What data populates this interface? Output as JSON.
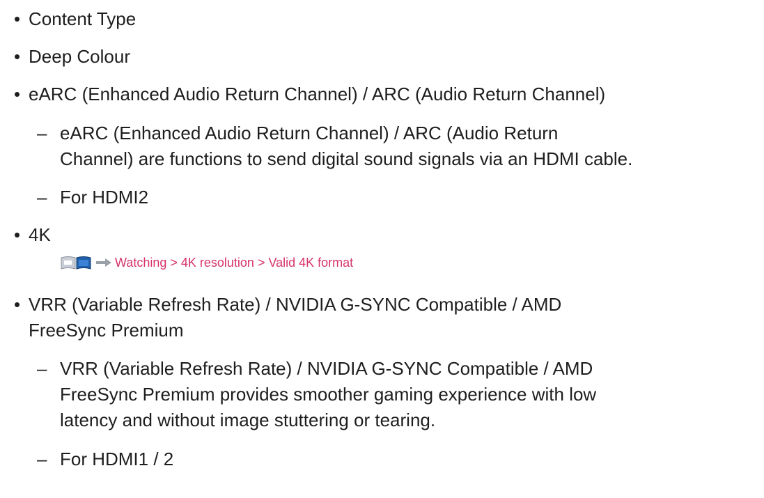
{
  "items": [
    {
      "bullet": "•",
      "text": "Content Type"
    },
    {
      "bullet": "•",
      "text": "Deep Colour"
    },
    {
      "bullet": "•",
      "text": "eARC (Enhanced Audio Return Channel) / ARC (Audio Return Channel)"
    },
    {
      "bullet": "•",
      "text": "4K"
    },
    {
      "bullet": "•",
      "lines": [
        "VRR (Variable Refresh Rate) / NVIDIA G-SYNC Compatible / AMD",
        "FreeSync Premium"
      ]
    }
  ],
  "sub_items": [
    {
      "dash": "–",
      "lines": [
        "eARC (Enhanced Audio Return Channel) / ARC (Audio Return",
        "Channel) are functions to send digital sound signals via an HDMI cable."
      ]
    },
    {
      "dash": "–",
      "text": "For HDMI2"
    },
    {
      "dash": "–",
      "lines": [
        "VRR (Variable Refresh Rate) / NVIDIA G-SYNC Compatible / AMD",
        "FreeSync Premium provides smoother gaming experience with low",
        "latency and without image stuttering or tearing."
      ]
    },
    {
      "dash": "–",
      "text": "For HDMI1 / 2"
    }
  ],
  "nav": {
    "icon": "ebook-icon",
    "arrow_icon": "arrow-right-icon",
    "path": "Watching > 4K resolution > Valid 4K format",
    "color": "#d6336c"
  }
}
